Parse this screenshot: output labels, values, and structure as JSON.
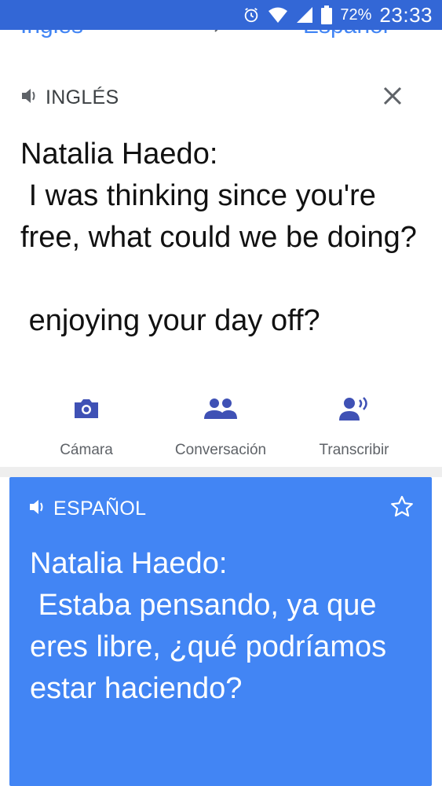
{
  "status_bar": {
    "battery_percent": "72%",
    "time": "23:33"
  },
  "lang_bar": {
    "source_language": "Inglés",
    "target_language": "Español"
  },
  "source_card": {
    "language_label": "INGLÉS",
    "text": "Natalia Haedo:\n I was thinking since you're free, what could we be doing?\n\n enjoying your day off?"
  },
  "actions": [
    {
      "label": "Cámara",
      "icon": "camera-icon"
    },
    {
      "label": "Conversación",
      "icon": "people-icon"
    },
    {
      "label": "Transcribir",
      "icon": "transcribe-icon"
    }
  ],
  "target_card": {
    "language_label": "ESPAÑOL",
    "text": "Natalia Haedo:\n Estaba pensando, ya que eres libre, ¿qué podríamos estar haciendo?"
  },
  "colors": {
    "accent": "#4285f4",
    "status_bar": "#3367d6",
    "icon_blue": "#3f51b5"
  }
}
